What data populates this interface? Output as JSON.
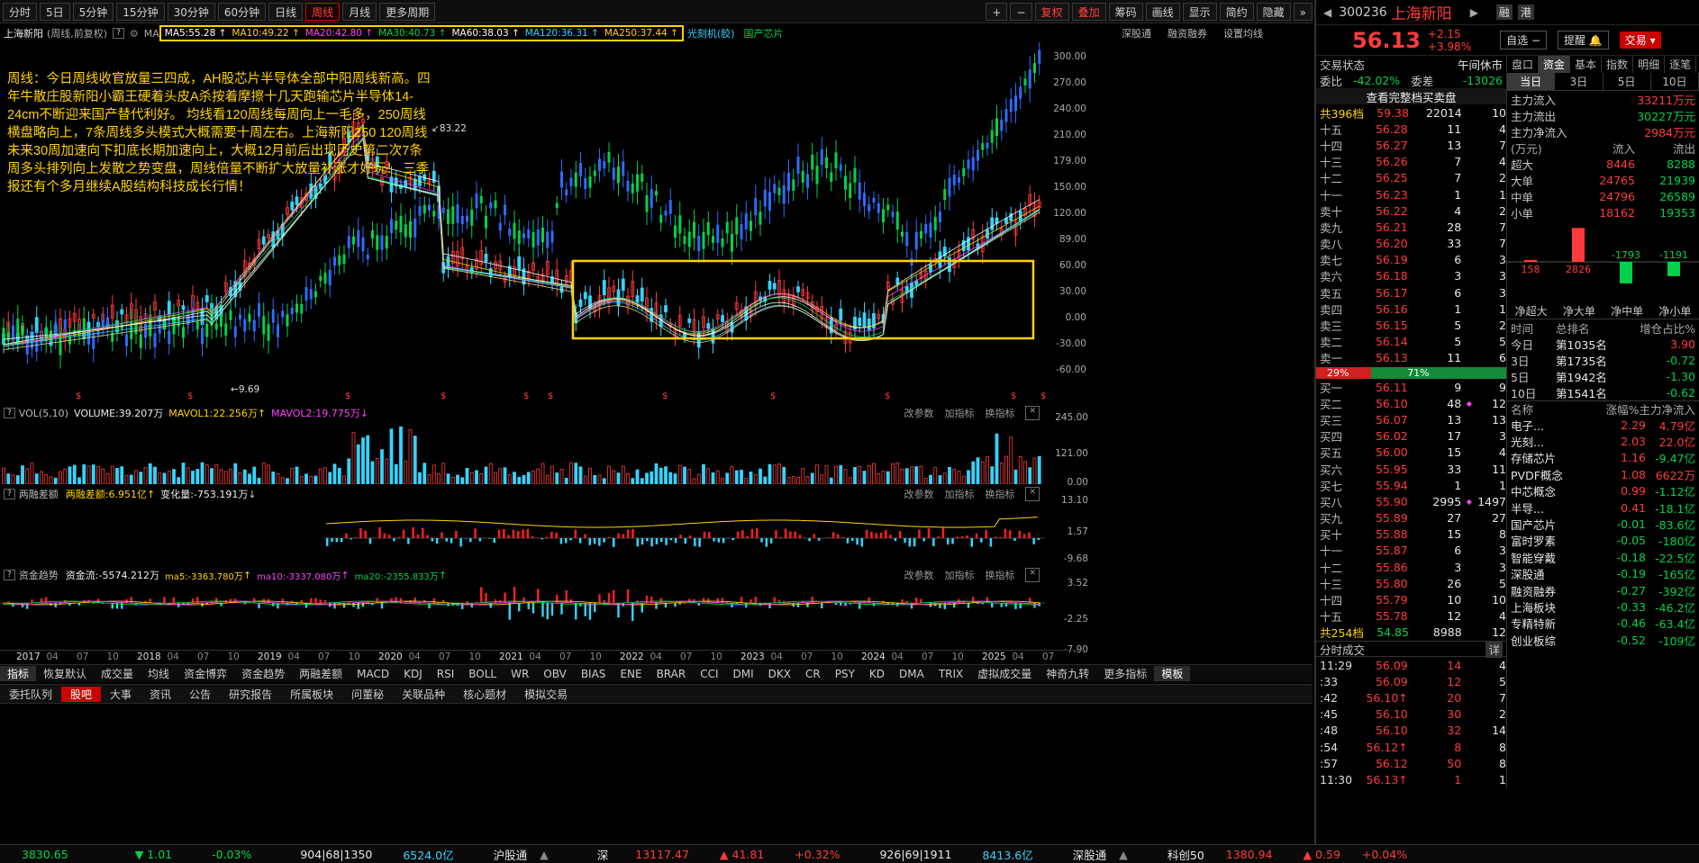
{
  "toolbar": {
    "periods": [
      "分时",
      "5日",
      "5分钟",
      "15分钟",
      "30分钟",
      "60分钟",
      "日线",
      "周线",
      "月线",
      "更多周期"
    ],
    "right": [
      "+",
      "−",
      "复权",
      "叠加",
      "筹码",
      "画线",
      "显示",
      "简约",
      "隐藏",
      "»"
    ]
  },
  "header": {
    "stock": "上海新阳",
    "mode": "(周线,前复权)",
    "ma_label": "MA",
    "ma": [
      "MA5:55.28",
      "MA10:49.22",
      "MA20:42.80",
      "MA30:40.73",
      "MA60:38.03",
      "MA120:36.31",
      "MA250:37.44"
    ],
    "tags": [
      "光刻机(胶)",
      "国产芯片"
    ],
    "links": [
      "深股通",
      "融资融券",
      "设置均线"
    ]
  },
  "note": "周线：今日周线收官放量三四成，AH股芯片半导体全部中阳周线新高。四年牛散庄股新阳小霸王硬着头皮A杀按着摩擦十几天跑输芯片半导体14-24cm不断迎来国产替代利好。\n均线看120周线每周向上一毛多，250周线横盘略向上，7条周线多头模式大概需要十周左右。上海新阳250 120周线未来30周加速向下扣底长期加速向上，大概12月前后出现历史第二次7条周多头排列向上发散之势变盘，周线倍量不断扩大放量补涨才好玩！ 三季报还有个多月继续A股结构科技成长行情！",
  "price_axis": [
    "300.00",
    "270.00",
    "240.00",
    "210.00",
    "179.00",
    "150.00",
    "120.00",
    "89.00",
    "60.00",
    "30.00",
    "0.00",
    "-30.00",
    "-60.00"
  ],
  "annot": {
    "high": "83.22",
    "low": "9.69"
  },
  "vol_panel": {
    "title": "VOL(5,10)",
    "vals": [
      "VOLUME:39.207万",
      "MAVOL1:22.256万",
      "MAVOL2:19.775万"
    ],
    "axis": [
      "245.00",
      "121.00",
      "0.00"
    ]
  },
  "margin_panel": {
    "title": "两融差额",
    "vals": [
      "两融差额:6.951亿",
      "变化量:-753.191万"
    ],
    "axis": [
      "13.10",
      "1.57",
      "-9.68"
    ]
  },
  "flow_panel": {
    "title": "资金趋势",
    "vals": [
      "资金流:-5574.212万",
      "ma5:-3363.780万",
      "ma10:-3337.080万",
      "ma20:-2355.833万"
    ],
    "axis": [
      "3.52",
      "-2.25",
      "-7.90"
    ]
  },
  "panel_links": [
    "改参数",
    "加指标",
    "换指标"
  ],
  "time_axis": [
    "2017",
    "04",
    "07",
    "10",
    "2018",
    "04",
    "07",
    "10",
    "2019",
    "04",
    "07",
    "10",
    "2020",
    "04",
    "07",
    "10",
    "2021",
    "04",
    "07",
    "10",
    "2022",
    "04",
    "07",
    "10",
    "2023",
    "04",
    "07",
    "10",
    "2024",
    "04",
    "07",
    "10",
    "2025",
    "04",
    "07"
  ],
  "indicators": [
    "指标",
    "恢复默认",
    "成交量",
    "均线",
    "资金博弈",
    "资金趋势",
    "两融差额",
    "MACD",
    "KDJ",
    "RSI",
    "BOLL",
    "WR",
    "OBV",
    "BIAS",
    "ENE",
    "BRAR",
    "CCI",
    "DMI",
    "DKX",
    "CR",
    "PSY",
    "KD",
    "DMA",
    "TRIX",
    "虚拟成交量",
    "神奇九转",
    "更多指标",
    "模板"
  ],
  "tabs": [
    "委托队列",
    "股吧",
    "大事",
    "资讯",
    "公告",
    "研究报告",
    "所属板块",
    "问董秘",
    "关联品种",
    "核心题材",
    "模拟交易"
  ],
  "status": {
    "sh": "3830.65",
    "sh_chg": "▼ 1.01",
    "sh_pct": "-0.03%",
    "sh_cnt": "904|68|1350",
    "sh_amt": "6524.0亿",
    "hgt": "沪股通",
    "sz_label": "深",
    "sz": "13117.47",
    "sz_chg": "▲ 41.81",
    "sz_pct": "+0.32%",
    "sz_cnt": "926|69|1911",
    "sz_amt": "8413.6亿",
    "sgt": "深股通",
    "kc_label": "科创50",
    "kc": "1380.94",
    "kc_chg": "▲ 0.59",
    "kc_pct": "+0.04%"
  },
  "quote": {
    "code": "300236",
    "name": "上海新阳",
    "price": "56.13",
    "chg": "+2.15",
    "pct": "+3.98%",
    "btn1": "融",
    "btn2": "港",
    "b_zx": "自选",
    "b_tx": "提醒",
    "b_jy": "交易",
    "status_label": "交易状态",
    "status": "午间休市",
    "wb_label": "委比",
    "wb": "-42.02%",
    "wc_label": "委差",
    "wc": "-13026",
    "full": "查看完整档买卖盘",
    "sell_total": [
      "共396档",
      "59.38",
      "22014",
      "10"
    ],
    "buy_total": [
      "共254档",
      "54.85",
      "8988",
      "12"
    ],
    "ratio": [
      "29%",
      "71%"
    ]
  },
  "asks": [
    [
      "十五",
      "56.28",
      "11",
      "4"
    ],
    [
      "十四",
      "56.27",
      "13",
      "7"
    ],
    [
      "十三",
      "56.26",
      "7",
      "4"
    ],
    [
      "十二",
      "56.25",
      "7",
      "2"
    ],
    [
      "十一",
      "56.23",
      "1",
      "1"
    ],
    [
      "卖十",
      "56.22",
      "4",
      "2"
    ],
    [
      "卖九",
      "56.21",
      "28",
      "7"
    ],
    [
      "卖八",
      "56.20",
      "33",
      "7"
    ],
    [
      "卖七",
      "56.19",
      "6",
      "3"
    ],
    [
      "卖六",
      "56.18",
      "3",
      "3"
    ],
    [
      "卖五",
      "56.17",
      "6",
      "3"
    ],
    [
      "卖四",
      "56.16",
      "1",
      "1"
    ],
    [
      "卖三",
      "56.15",
      "5",
      "2"
    ],
    [
      "卖二",
      "56.14",
      "5",
      "5"
    ],
    [
      "卖一",
      "56.13",
      "11",
      "6"
    ]
  ],
  "bids": [
    [
      "买一",
      "56.11",
      "9",
      "9"
    ],
    [
      "买二",
      "56.10",
      "48",
      "12"
    ],
    [
      "买三",
      "56.07",
      "13",
      "13"
    ],
    [
      "买四",
      "56.02",
      "17",
      "3"
    ],
    [
      "买五",
      "56.00",
      "15",
      "4"
    ],
    [
      "买六",
      "55.95",
      "33",
      "11"
    ],
    [
      "买七",
      "55.94",
      "1",
      "1"
    ],
    [
      "买八",
      "55.90",
      "2995",
      "1497"
    ],
    [
      "买九",
      "55.89",
      "27",
      "27"
    ],
    [
      "买十",
      "55.88",
      "15",
      "8"
    ],
    [
      "十一",
      "55.87",
      "6",
      "3"
    ],
    [
      "十二",
      "55.86",
      "3",
      "3"
    ],
    [
      "十三",
      "55.80",
      "26",
      "5"
    ],
    [
      "十四",
      "55.79",
      "10",
      "10"
    ],
    [
      "十五",
      "55.78",
      "12",
      "4"
    ]
  ],
  "ticks_title": "分时成交",
  "ticks_btn": "详",
  "ticks": [
    [
      "11:29",
      "56.09",
      "14",
      "4"
    ],
    [
      ":33",
      "56.09",
      "12",
      "5"
    ],
    [
      ":42",
      "56.10↑",
      "20",
      "7"
    ],
    [
      ":45",
      "56.10",
      "30",
      "2"
    ],
    [
      ":48",
      "56.10",
      "32",
      "14"
    ],
    [
      ":54",
      "56.12↑",
      "8",
      "8"
    ],
    [
      ":57",
      "56.12",
      "50",
      "8"
    ],
    [
      "11:30",
      "56.13↑",
      "1",
      "1"
    ]
  ],
  "fund_tabs": [
    "盘口",
    "资金",
    "基本",
    "指数",
    "明细",
    "逐笔"
  ],
  "fund_days": [
    "当日",
    "3日",
    "5日",
    "10日"
  ],
  "fund": {
    "in_label": "主力流入",
    "in": "33211万元",
    "out_label": "主力流出",
    "out": "30227万元",
    "net_label": "主力净流入",
    "net": "2984万元",
    "unit": "(万元)",
    "in_h": "流入",
    "out_h": "流出"
  },
  "fund_rows": [
    [
      "超大",
      "8446",
      "8288"
    ],
    [
      "大单",
      "24765",
      "21939"
    ],
    [
      "中单",
      "24796",
      "26589"
    ],
    [
      "小单",
      "18162",
      "19353"
    ]
  ],
  "net_bars": [
    {
      "label": "净超大",
      "value": 158
    },
    {
      "label": "净大单",
      "value": 2826
    },
    {
      "label": "净中单",
      "value": -1793
    },
    {
      "label": "净小单",
      "value": -1191
    }
  ],
  "rank_head": [
    "时间",
    "总排名",
    "增仓占比%"
  ],
  "ranks": [
    [
      "今日",
      "第1035名",
      "3.90"
    ],
    [
      "3日",
      "第1735名",
      "-0.72"
    ],
    [
      "5日",
      "第1942名",
      "-1.30"
    ],
    [
      "10日",
      "第1541名",
      "-0.62"
    ]
  ],
  "sector_head": [
    "名称",
    "涨幅%",
    "主力净流入"
  ],
  "sectors": [
    [
      "电子...",
      "2.29",
      "4.79亿"
    ],
    [
      "光刻...",
      "2.03",
      "22.0亿"
    ],
    [
      "存储芯片",
      "1.16",
      "-9.47亿"
    ],
    [
      "PVDF概念",
      "1.08",
      "6622万"
    ],
    [
      "中芯概念",
      "0.99",
      "-1.12亿"
    ],
    [
      "半导...",
      "0.41",
      "-18.1亿"
    ],
    [
      "国产芯片",
      "-0.01",
      "-83.6亿"
    ],
    [
      "富时罗素",
      "-0.05",
      "-180亿"
    ],
    [
      "智能穿戴",
      "-0.18",
      "-22.5亿"
    ],
    [
      "深股通",
      "-0.19",
      "-165亿"
    ],
    [
      "融资融券",
      "-0.27",
      "-392亿"
    ],
    [
      "上海板块",
      "-0.33",
      "-46.2亿"
    ],
    [
      "专精特新",
      "-0.46",
      "-63.4亿"
    ],
    [
      "创业板综",
      "-0.52",
      "-109亿"
    ]
  ],
  "colors": {
    "up": "#ff3b3b",
    "down": "#00d34b",
    "accent": "#ffd400",
    "bg": "#000000"
  }
}
